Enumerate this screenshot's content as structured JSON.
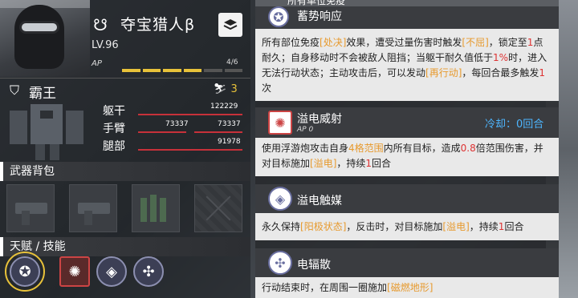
{
  "character": {
    "name": "夺宝猎人β",
    "level": "LV.96",
    "ap_label": "AP",
    "ap_value": "4/6",
    "ap_filled": 4,
    "ap_total": 6
  },
  "mech": {
    "name": "霸王",
    "badge_count": "3",
    "parts": [
      {
        "label": "躯干",
        "value": "122229"
      },
      {
        "label": "手臂",
        "value_left": "73337",
        "value_right": "73337"
      },
      {
        "label": "腿部",
        "value": "91978"
      }
    ]
  },
  "sections": {
    "weapons": "武器背包",
    "talents": "天赋 / 技能"
  },
  "top_cut_text": "所有单位免疫",
  "skills_panel": {
    "skill1": {
      "title": "蓄势响应",
      "desc_parts": [
        {
          "t": "所有部位免疫"
        },
        {
          "t": "[处决]",
          "c": "hl"
        },
        {
          "t": "效果，遭受过量伤害时触发"
        },
        {
          "t": "[不屈]",
          "c": "hl"
        },
        {
          "t": "，锁定至"
        },
        {
          "t": "1",
          "c": "num"
        },
        {
          "t": "点耐久；自身移动时不会被敌人阻挡；当躯干耐久值低于"
        },
        {
          "t": "1%",
          "c": "num"
        },
        {
          "t": "时，进入无法行动状态；主动攻击后，可以发动"
        },
        {
          "t": "[再行动]",
          "c": "hl"
        },
        {
          "t": "，每回合最多触发"
        },
        {
          "t": "1",
          "c": "num"
        },
        {
          "t": "次"
        }
      ]
    },
    "skill2": {
      "title": "溢电威射",
      "ap": "AP 0",
      "cooldown": "冷却：0回合",
      "desc_parts": [
        {
          "t": "使用浮游炮攻击自身"
        },
        {
          "t": "4格范围",
          "c": "hl"
        },
        {
          "t": "内所有目标，造成"
        },
        {
          "t": "0.8",
          "c": "num"
        },
        {
          "t": "倍范围伤害，并对目标施加"
        },
        {
          "t": "[溢电]",
          "c": "hl"
        },
        {
          "t": "，持续"
        },
        {
          "t": "1",
          "c": "num"
        },
        {
          "t": "回合"
        }
      ]
    },
    "skill3": {
      "title": "溢电触媒",
      "desc_parts": [
        {
          "t": "永久保持"
        },
        {
          "t": "[阳极状态]",
          "c": "hl"
        },
        {
          "t": "，反击时，对目标施加"
        },
        {
          "t": "[溢电]",
          "c": "hl"
        },
        {
          "t": "，持续"
        },
        {
          "t": "1",
          "c": "num"
        },
        {
          "t": "回合"
        }
      ]
    },
    "skill4": {
      "title": "电辐散",
      "desc_parts": [
        {
          "t": "行动结束时，在周围一圈施加"
        },
        {
          "t": "[磁燃地形]",
          "c": "hl"
        }
      ]
    }
  },
  "colors": {
    "accent_yellow": "#e8c23a",
    "damage_red": "#c7313a",
    "highlight_orange": "#e79a2e",
    "cooldown_blue": "#4db6ff"
  }
}
